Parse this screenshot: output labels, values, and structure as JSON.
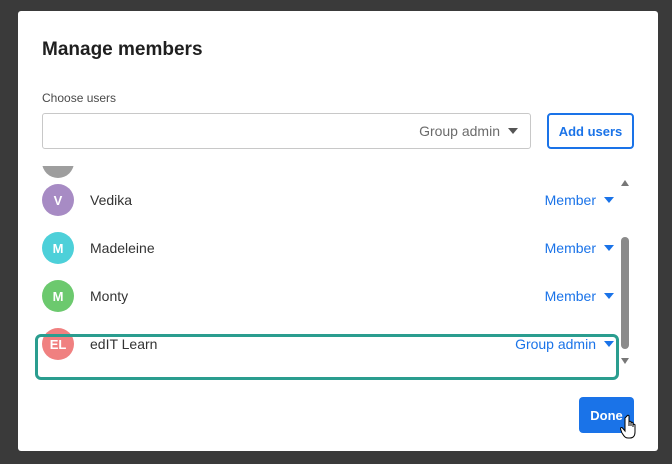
{
  "dialog": {
    "title": "Manage members",
    "choose_users_label": "Choose users",
    "input_value": "",
    "input_role": "Group admin",
    "add_button": "Add users",
    "done_button": "Done"
  },
  "members": [
    {
      "initials": "V",
      "name": "Vedika",
      "role": "Member",
      "color": "#a78bc4"
    },
    {
      "initials": "M",
      "name": "Madeleine",
      "role": "Member",
      "color": "#4dd0d9"
    },
    {
      "initials": "M",
      "name": "Monty",
      "role": "Member",
      "color": "#6cc96e"
    },
    {
      "initials": "EL",
      "name": "edIT Learn",
      "role": "Group admin",
      "color": "#f08080"
    }
  ],
  "colors": {
    "accent": "#1a73e8",
    "highlight": "#2a9d8f"
  },
  "icons": {
    "dropdown": "caret-down-icon",
    "cursor": "hand-pointer-icon"
  }
}
